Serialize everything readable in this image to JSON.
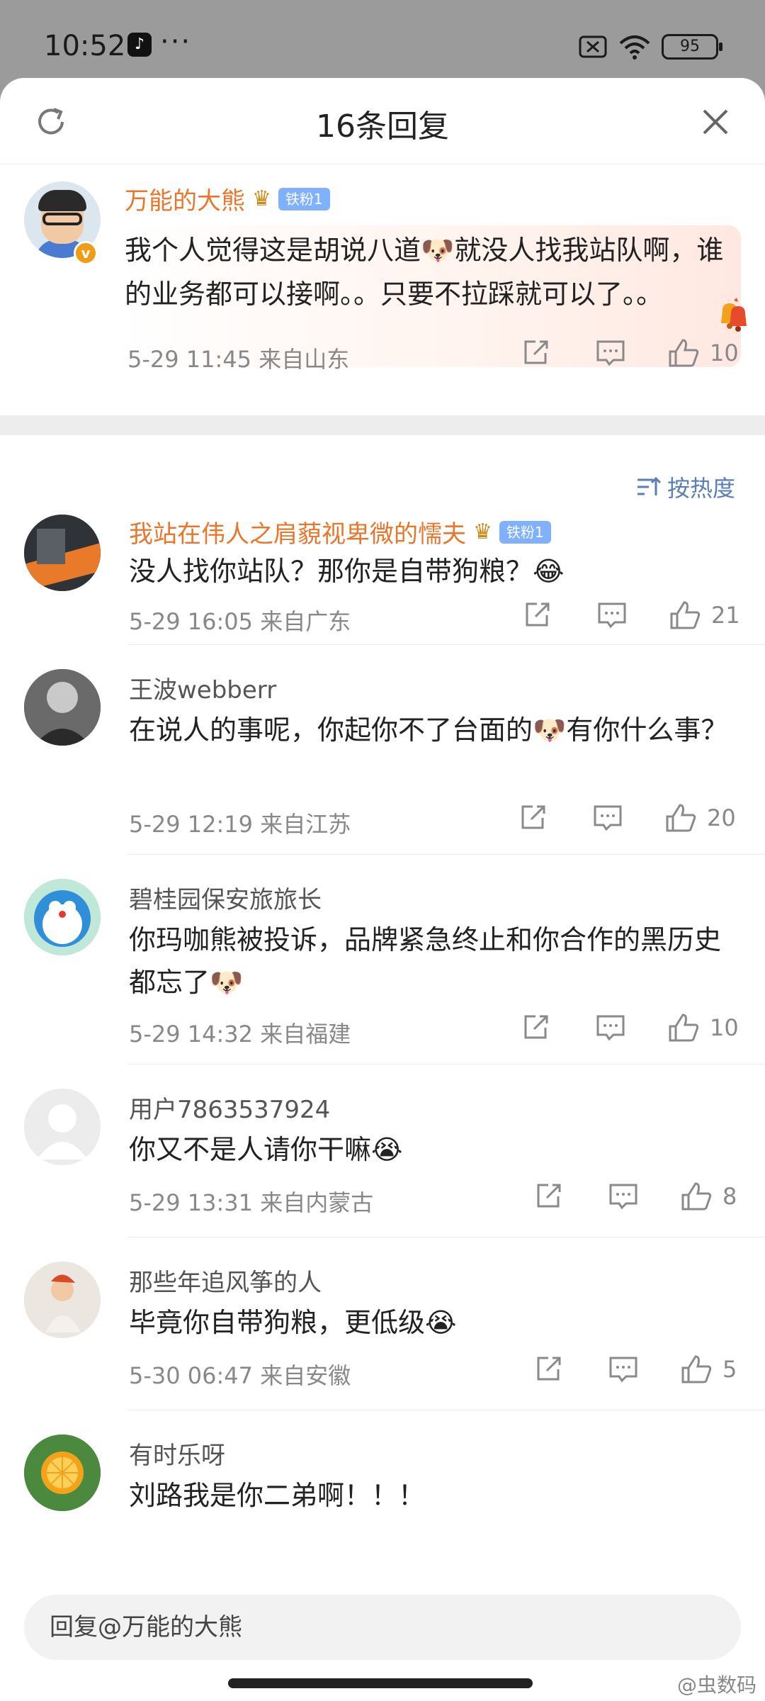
{
  "status_bar": {
    "time": "10:52",
    "app_icon": "tiktok-icon",
    "more_dots": "···",
    "battery": "95"
  },
  "header": {
    "title": "16条回复",
    "refresh_icon": "refresh-icon",
    "close_icon": "close-icon"
  },
  "original_comment": {
    "username": "万能的大熊",
    "fan_badge": "铁粉1",
    "text": "我个人觉得这是胡说八道🐶就没人找我站队啊，谁的业务都可以接啊。。只要不拉踩就可以了。。",
    "time_location": "5-29 11:45  来自山东",
    "likes": "10"
  },
  "sort": {
    "label": "按热度"
  },
  "replies": [
    {
      "username": "我站在伟人之肩藐视卑微的懦夫",
      "fan_badge": "铁粉1",
      "text": "没人找你站队？那你是自带狗粮？😂",
      "time_location": "5-29 16:05  来自广东",
      "likes": "21"
    },
    {
      "username": "王波webberr",
      "text": "在说人的事呢，你起你不了台面的🐶有你什么事？",
      "time_location": "5-29 12:19  来自江苏",
      "likes": "20"
    },
    {
      "username": "碧桂园保安旅旅长",
      "text": "你玛咖熊被投诉，品牌紧急终止和你合作的黑历史都忘了🐶",
      "time_location": "5-29 14:32  来自福建",
      "likes": "10"
    },
    {
      "username": "用户7863537924",
      "text": "你又不是人请你干嘛😭",
      "time_location": "5-29 13:31  来自内蒙古",
      "likes": "8"
    },
    {
      "username": "那些年追风筝的人",
      "text": "毕竟你自带狗粮，更低级😭",
      "time_location": "5-30 06:47  来自安徽",
      "likes": "5"
    },
    {
      "username": "有时乐呀",
      "text": "刘路我是你二弟啊！！！"
    }
  ],
  "reply_input": {
    "placeholder": "回复@万能的大熊"
  },
  "watermark": "@虫数码"
}
